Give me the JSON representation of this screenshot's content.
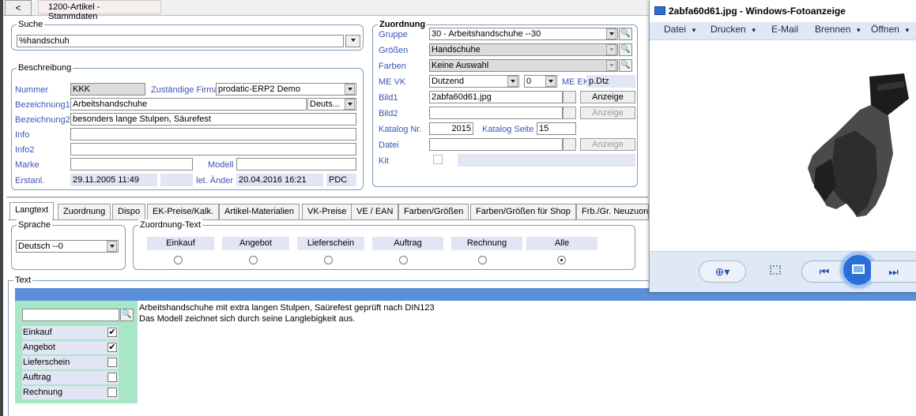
{
  "top": {
    "back_label": "<",
    "tab_title": "1200-Artikel - Stammdaten"
  },
  "suche": {
    "title": "Suche",
    "value": "%handschuh"
  },
  "beschreibung": {
    "title": "Beschreibung",
    "nummer_label": "Nummer",
    "nummer": "KKK",
    "firma_label": "Zuständige Firma",
    "firma": "prodatic-ERP2 Demo",
    "bez1_label": "Bezeichnung1",
    "bez1": "Arbeitshandschuhe",
    "lang": "Deuts...",
    "bez2_label": "Bezeichnung2",
    "bez2": "besonders lange Stulpen, Säurefest",
    "info_label": "Info",
    "info2_label": "Info2",
    "marke_label": "Marke",
    "modell_label": "Modell",
    "erstanl_label": "Erstanl.",
    "erstanl": "29.11.2005 11:49",
    "letaend_label": "let. Änder",
    "letaend": "20.04.2016 16:21",
    "user": "PDC"
  },
  "zuordnung": {
    "title": "Zuordnung",
    "gruppe_label": "Gruppe",
    "gruppe": "30 - Arbeitshandschuhe  --30",
    "groessen_label": "Größen",
    "groessen": "Handschuhe",
    "farben_label": "Farben",
    "farben": "Keine Auswahl",
    "mevk_label": "ME VK",
    "mevk": "Dutzend",
    "mevk_num": "0",
    "meek_label": "ME EK",
    "meek": "p.Dtz",
    "bild1_label": "Bild1",
    "bild1": "2abfa60d61.jpg",
    "anzeige": "Anzeige",
    "bild2_label": "Bild2",
    "katalog_label": "Katalog Nr.",
    "katalog": "2015",
    "kseite_label": "Katalog Seite",
    "kseite": "15",
    "datei_label": "Datei",
    "kit_label": "Kit"
  },
  "tabs": [
    "Langtext",
    "Zuordnung",
    "Dispo",
    "EK-Preise/Kalk.",
    "Artikel-Materialien",
    "VK-Preise",
    "VE / EAN",
    "Farben/Größen",
    "Farben/Größen für Shop",
    "Frb./Gr. Neuzuord"
  ],
  "sprache": {
    "title": "Sprache",
    "value": "Deutsch  --0"
  },
  "zuordnung_text": {
    "title": "Zuordnung-Text",
    "items": [
      "Einkauf",
      "Angebot",
      "Lieferschein",
      "Auftrag",
      "Rechnung",
      "Alle"
    ],
    "selected": "Alle"
  },
  "text": {
    "title": "Text",
    "line1": "Arbeitshandschuhe mit extra langen Stulpen, Saürefest geprüft nach DIN123",
    "line2": "Das Modell zeichnet sich durch seine Langlebigkeit aus.",
    "checks": [
      {
        "label": "Einkauf",
        "checked": true
      },
      {
        "label": "Angebot",
        "checked": true
      },
      {
        "label": "Lieferschein",
        "checked": false
      },
      {
        "label": "Auftrag",
        "checked": false
      },
      {
        "label": "Rechnung",
        "checked": false
      }
    ]
  },
  "viewer": {
    "title": "2abfa60d61.jpg - Windows-Fotoanzeige",
    "menu": [
      "Datei",
      "Drucken",
      "E-Mail",
      "Brennen",
      "Öffnen"
    ],
    "image_icon": "glove-photo",
    "colors": {
      "titlebar": "#ffffff",
      "menubar": "#dfe9f5",
      "accent": "#2a6fd6"
    }
  }
}
